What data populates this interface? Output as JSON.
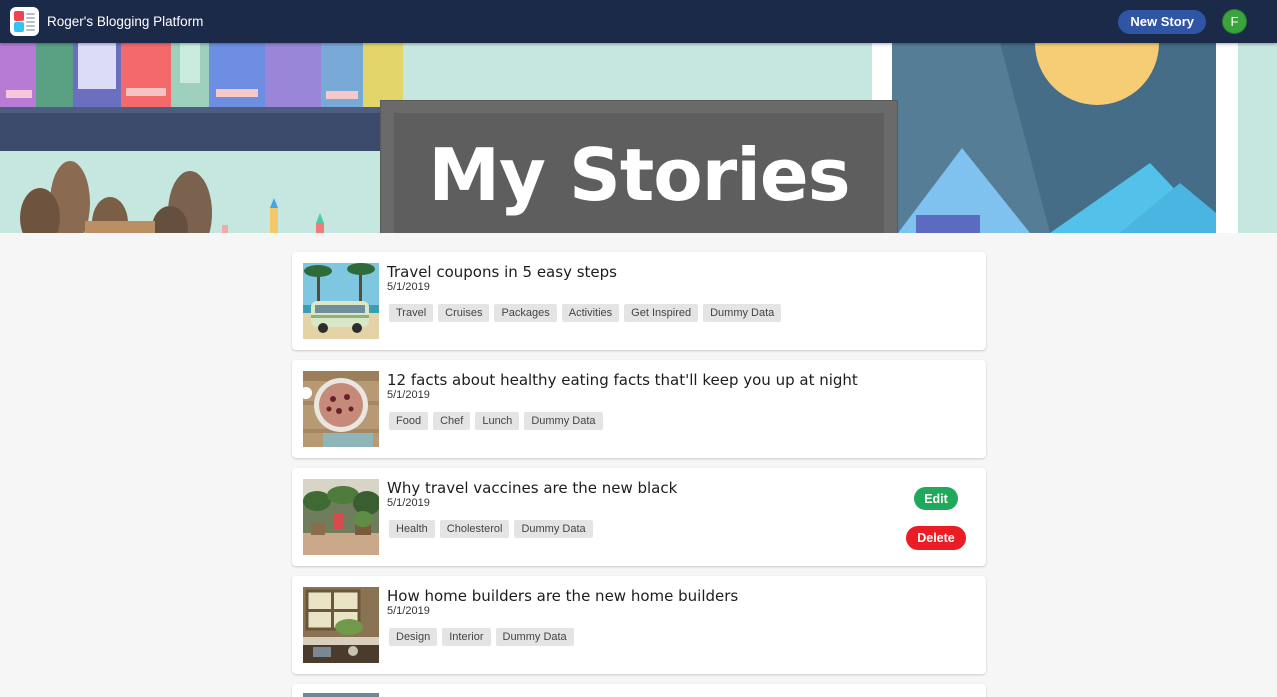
{
  "app": {
    "title": "Roger's Blogging Platform",
    "new_story_label": "New Story",
    "avatar_initial": "F"
  },
  "hero": {
    "title": "My Stories"
  },
  "stories": [
    {
      "title": "Travel coupons in 5 easy steps",
      "date": "5/1/2019",
      "tags": [
        "Travel",
        "Cruises",
        "Packages",
        "Activities",
        "Get Inspired",
        "Dummy Data"
      ],
      "thumbnail": "beach-van-image"
    },
    {
      "title": "12 facts about healthy eating facts that'll keep you up at night",
      "date": "5/1/2019",
      "tags": [
        "Food",
        "Chef",
        "Lunch",
        "Dummy Data"
      ],
      "thumbnail": "pizza-image"
    },
    {
      "title": "Why travel vaccines are the new black",
      "date": "5/1/2019",
      "tags": [
        "Health",
        "Cholesterol",
        "Dummy Data"
      ],
      "thumbnail": "garden-image",
      "actions": {
        "edit_label": "Edit",
        "delete_label": "Delete"
      }
    },
    {
      "title": "How home builders are the new home builders",
      "date": "5/1/2019",
      "tags": [
        "Design",
        "Interior",
        "Dummy Data"
      ],
      "thumbnail": "interior-image"
    }
  ],
  "colors": {
    "navbar": "#1c2a4a",
    "new_story_button": "#2f55a4",
    "avatar": "#3ba33e",
    "edit_button": "#21a95b",
    "delete_button": "#ec1c24"
  }
}
